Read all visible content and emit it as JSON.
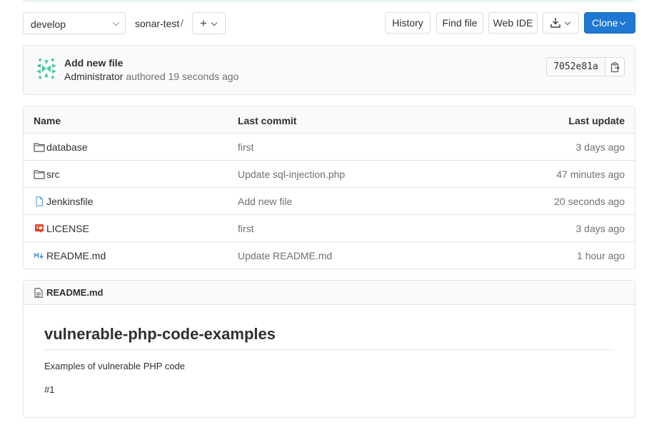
{
  "toolbar": {
    "branch": "develop",
    "breadcrumb": "sonar-test",
    "breadcrumb_separator": "/",
    "add_icon": "plus-icon",
    "history_label": "History",
    "find_file_label": "Find file",
    "web_ide_label": "Web IDE",
    "download_icon": "download-icon",
    "clone_label": "Clone",
    "accent_color": "#1f78d1"
  },
  "last_commit": {
    "title": "Add new file",
    "author": "Administrator",
    "meta": " authored 19 seconds ago",
    "sha": "7052e81a",
    "copy_icon": "clipboard-icon"
  },
  "files": {
    "headers": {
      "name": "Name",
      "last_commit": "Last commit",
      "last_update": "Last update"
    },
    "rows": [
      {
        "icon": "folder-icon",
        "name": "database",
        "commit": "first",
        "updated": "3 days ago"
      },
      {
        "icon": "folder-icon",
        "name": "src",
        "commit": "Update sql-injection.php",
        "updated": "47 minutes ago"
      },
      {
        "icon": "file-icon",
        "name": "Jenkinsfile",
        "commit": "Add new file",
        "updated": "20 seconds ago"
      },
      {
        "icon": "license-icon",
        "name": "LICENSE",
        "commit": "first",
        "updated": "3 days ago"
      },
      {
        "icon": "markdown-icon",
        "name": "README.md",
        "commit": "Update README.md",
        "updated": "1 hour ago"
      }
    ]
  },
  "readme": {
    "filename": "README.md",
    "heading": "vulnerable-php-code-examples",
    "paragraph1": "Examples of vulnerable PHP code",
    "paragraph2": "#1"
  }
}
